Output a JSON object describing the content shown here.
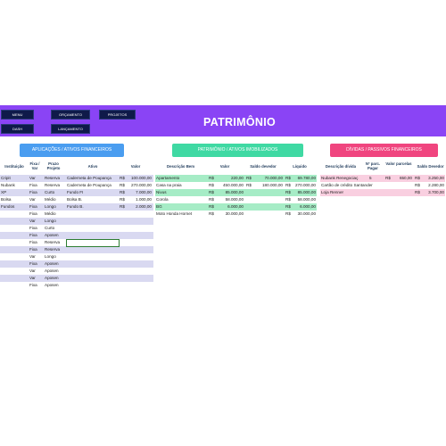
{
  "banner": {
    "title": "PATRIMÔNIO"
  },
  "nav": {
    "menu": "MENU",
    "orcamento": "ORÇAMENTO",
    "projetos": "PROJETOS",
    "dash": "DASH",
    "lancamento": "LANÇAMENTO"
  },
  "colors": {
    "banner": "#8a44f5",
    "aplicacoes": "#4a9df0",
    "patrimonio": "#3fd9a3",
    "dividas": "#f0457f",
    "nav": "#0f1a4a"
  },
  "aplicacoes": {
    "header": "APLICAÇÕES / ATIVOS FINANCEIROS",
    "columns": [
      "Instituição",
      "Fixa / Var",
      "Prazo Projeto",
      "Ativo",
      "Valor"
    ],
    "rows": [
      {
        "inst": "Cripit",
        "tipo": "Var",
        "prazo": "Reserva",
        "ativo": "Caderneta de Poupança",
        "cur": "R$",
        "valor": "100.000,00"
      },
      {
        "inst": "Nubank",
        "tipo": "Fixa",
        "prazo": "Reserva",
        "ativo": "Caderneta de Poupança",
        "cur": "R$",
        "valor": "270.000,00"
      },
      {
        "inst": "XP",
        "tipo": "Fixa",
        "prazo": "Curto",
        "ativo": "Fundo FI",
        "cur": "R$",
        "valor": "7.000,00"
      },
      {
        "inst": "Bolsa",
        "tipo": "Var",
        "prazo": "Médio",
        "ativo": "Bolsa B.",
        "cur": "R$",
        "valor": "1.000,00"
      },
      {
        "inst": "Fundos",
        "tipo": "Fixa",
        "prazo": "Longo",
        "ativo": "Fundo B.",
        "cur": "R$",
        "valor": "2.000,00"
      },
      {
        "inst": "",
        "tipo": "Fixa",
        "prazo": "Médio",
        "ativo": "",
        "cur": "",
        "valor": ""
      },
      {
        "inst": "",
        "tipo": "Var",
        "prazo": "Longo",
        "ativo": "",
        "cur": "",
        "valor": ""
      },
      {
        "inst": "",
        "tipo": "Fixa",
        "prazo": "Curto",
        "ativo": "",
        "cur": "",
        "valor": ""
      },
      {
        "inst": "",
        "tipo": "Fixa",
        "prazo": "Aposen",
        "ativo": "",
        "cur": "",
        "valor": ""
      },
      {
        "inst": "",
        "tipo": "Fixa",
        "prazo": "Reserva",
        "ativo": "",
        "cur": "",
        "valor": ""
      },
      {
        "inst": "",
        "tipo": "Fixa",
        "prazo": "Reserva",
        "ativo": "",
        "cur": "",
        "valor": ""
      },
      {
        "inst": "",
        "tipo": "Var",
        "prazo": "Longo",
        "ativo": "",
        "cur": "",
        "valor": ""
      },
      {
        "inst": "",
        "tipo": "Fixa",
        "prazo": "Aposen",
        "ativo": "",
        "cur": "",
        "valor": ""
      },
      {
        "inst": "",
        "tipo": "Var",
        "prazo": "Aposen",
        "ativo": "",
        "cur": "",
        "valor": ""
      },
      {
        "inst": "",
        "tipo": "Var",
        "prazo": "Aposen",
        "ativo": "",
        "cur": "",
        "valor": ""
      },
      {
        "inst": "",
        "tipo": "Fixa",
        "prazo": "Aposen",
        "ativo": "",
        "cur": "",
        "valor": ""
      }
    ]
  },
  "patrimonio": {
    "header": "PATRIMÔNIO / ATIVOS IMOBILIZADOS",
    "columns": [
      "Descrição Bem",
      "Valor",
      "Saldo devedor",
      "Líquido"
    ],
    "rows": [
      {
        "desc": "Apartamento",
        "c1": "R$",
        "valor": "220,00",
        "c2": "R$",
        "saldo": "70.000,00",
        "c3": "R$",
        "liquido": "69.780,00",
        "hl": true
      },
      {
        "desc": "Casa na praia",
        "c1": "R$",
        "valor": "450.000,00",
        "c2": "R$",
        "saldo": "180.000,00",
        "c3": "R$",
        "liquido": "270.000,00",
        "hl": false
      },
      {
        "desc": "Nivus",
        "c1": "R$",
        "valor": "85.000,00",
        "c2": "",
        "saldo": "",
        "c3": "R$",
        "liquido": "85.000,00",
        "hl": true
      },
      {
        "desc": "Corola",
        "c1": "R$",
        "valor": "58.000,00",
        "c2": "",
        "saldo": "",
        "c3": "R$",
        "liquido": "58.000,00",
        "hl": false
      },
      {
        "desc": "BG",
        "c1": "R$",
        "valor": "6.000,00",
        "c2": "",
        "saldo": "",
        "c3": "R$",
        "liquido": "6.000,00",
        "hl": true
      },
      {
        "desc": "Moto Honda Hornet",
        "c1": "R$",
        "valor": "30.000,00",
        "c2": "",
        "saldo": "",
        "c3": "R$",
        "liquido": "30.000,00",
        "hl": false
      }
    ]
  },
  "dividas": {
    "header": "DÍVIDAS / PASSIVOS FINANCEIROS",
    "columns": [
      "Descrição dívida",
      "Nº parc. Pagar",
      "Valor parcelas",
      "Saldo Devedor"
    ],
    "rows": [
      {
        "desc": "Nubank Renegociaç",
        "parc": "5",
        "c1": "R$",
        "valor": "650,00",
        "c2": "R$",
        "saldo": "3.250,00",
        "hl": true
      },
      {
        "desc": "Cartão de crédito Santander",
        "parc": "",
        "c1": "",
        "valor": "",
        "c2": "R$",
        "saldo": "2.280,00",
        "hl": false
      },
      {
        "desc": "Loja Renner",
        "parc": "",
        "c1": "",
        "valor": "",
        "c2": "R$",
        "saldo": "3.700,00",
        "hl": true
      }
    ]
  }
}
